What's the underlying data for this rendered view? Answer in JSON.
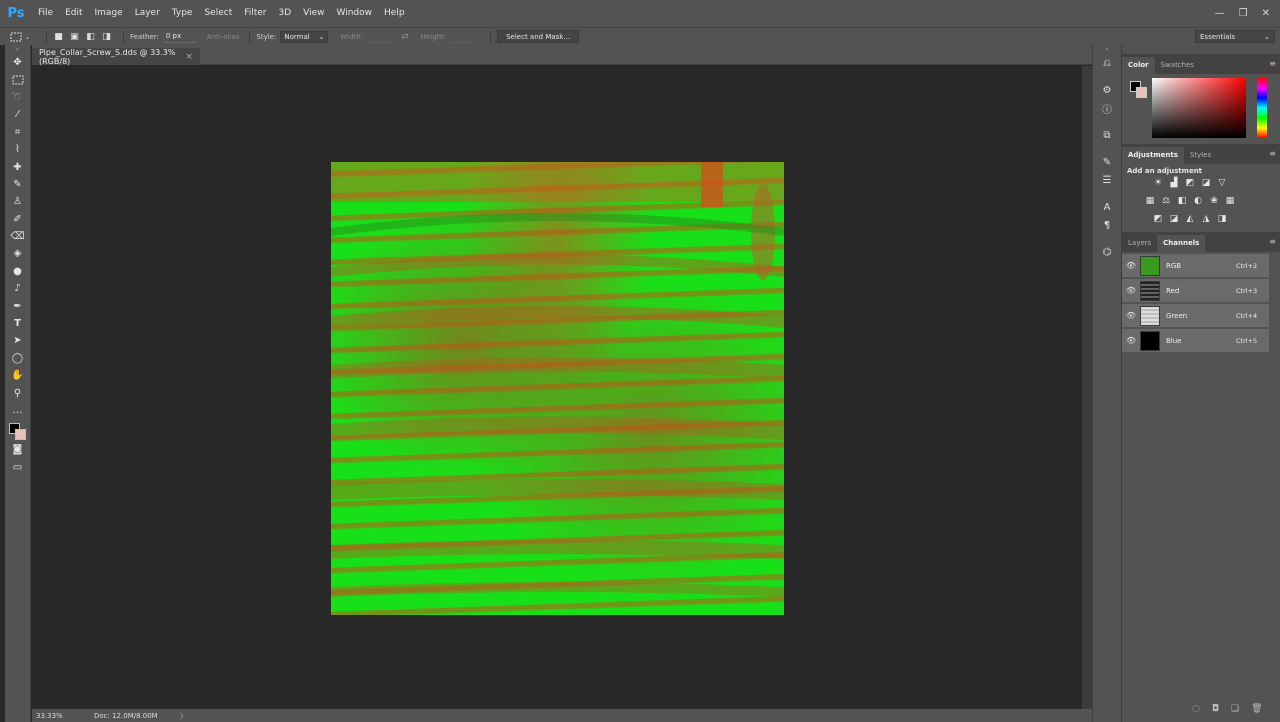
{
  "app": {
    "logo": "Ps"
  },
  "menu": [
    "File",
    "Edit",
    "Image",
    "Layer",
    "Type",
    "Select",
    "Filter",
    "3D",
    "View",
    "Window",
    "Help"
  ],
  "window_controls": {
    "minimize": "—",
    "restore": "❐",
    "close": "✕"
  },
  "options": {
    "feather_label": "Feather:",
    "feather_value": "0 px",
    "antialias_label": "Anti-alias",
    "style_label": "Style:",
    "style_value": "Normal",
    "width_label": "Width:",
    "height_label": "Height:",
    "select_mask_label": "Select and Mask...",
    "workspace": "Essentials"
  },
  "document": {
    "tab_title": "Pipe_Collar_Screw_S.dds @ 33.3% (RGB/8)",
    "tab_close": "×"
  },
  "status": {
    "zoom": "33.33%",
    "doc_info": "Doc: 12.0M/8.00M",
    "arrow": "〉"
  },
  "panels": {
    "color_tabs": [
      "Color",
      "Swatches"
    ],
    "adjustment_tabs": [
      "Adjustments",
      "Styles"
    ],
    "add_adjustment": "Add an adjustment",
    "layer_tabs": [
      "Layers",
      "Channels"
    ]
  },
  "colors": {
    "foreground": "#000000",
    "background": "#e8c4b8",
    "accent": "#31a8ff",
    "canvas_green": "#18e018",
    "canvas_rust": "#be5514"
  },
  "channels": [
    {
      "name": "RGB",
      "shortcut": "Ctrl+2",
      "thumb": "rgb"
    },
    {
      "name": "Red",
      "shortcut": "Ctrl+3",
      "thumb": "red"
    },
    {
      "name": "Green",
      "shortcut": "Ctrl+4",
      "thumb": "green"
    },
    {
      "name": "Blue",
      "shortcut": "Ctrl+5",
      "thumb": "blue"
    }
  ],
  "tools": [
    "move-icon",
    "marquee-icon",
    "lasso-icon",
    "magic-wand-icon",
    "crop-icon",
    "eyedropper-icon",
    "healing-brush-icon",
    "brush-icon",
    "clone-stamp-icon",
    "history-brush-icon",
    "eraser-icon",
    "paint-bucket-icon",
    "blur-icon",
    "dodge-icon",
    "pen-icon",
    "type-icon",
    "path-selection-icon",
    "ellipse-icon",
    "hand-icon",
    "zoom-icon",
    "more-tools-icon"
  ]
}
